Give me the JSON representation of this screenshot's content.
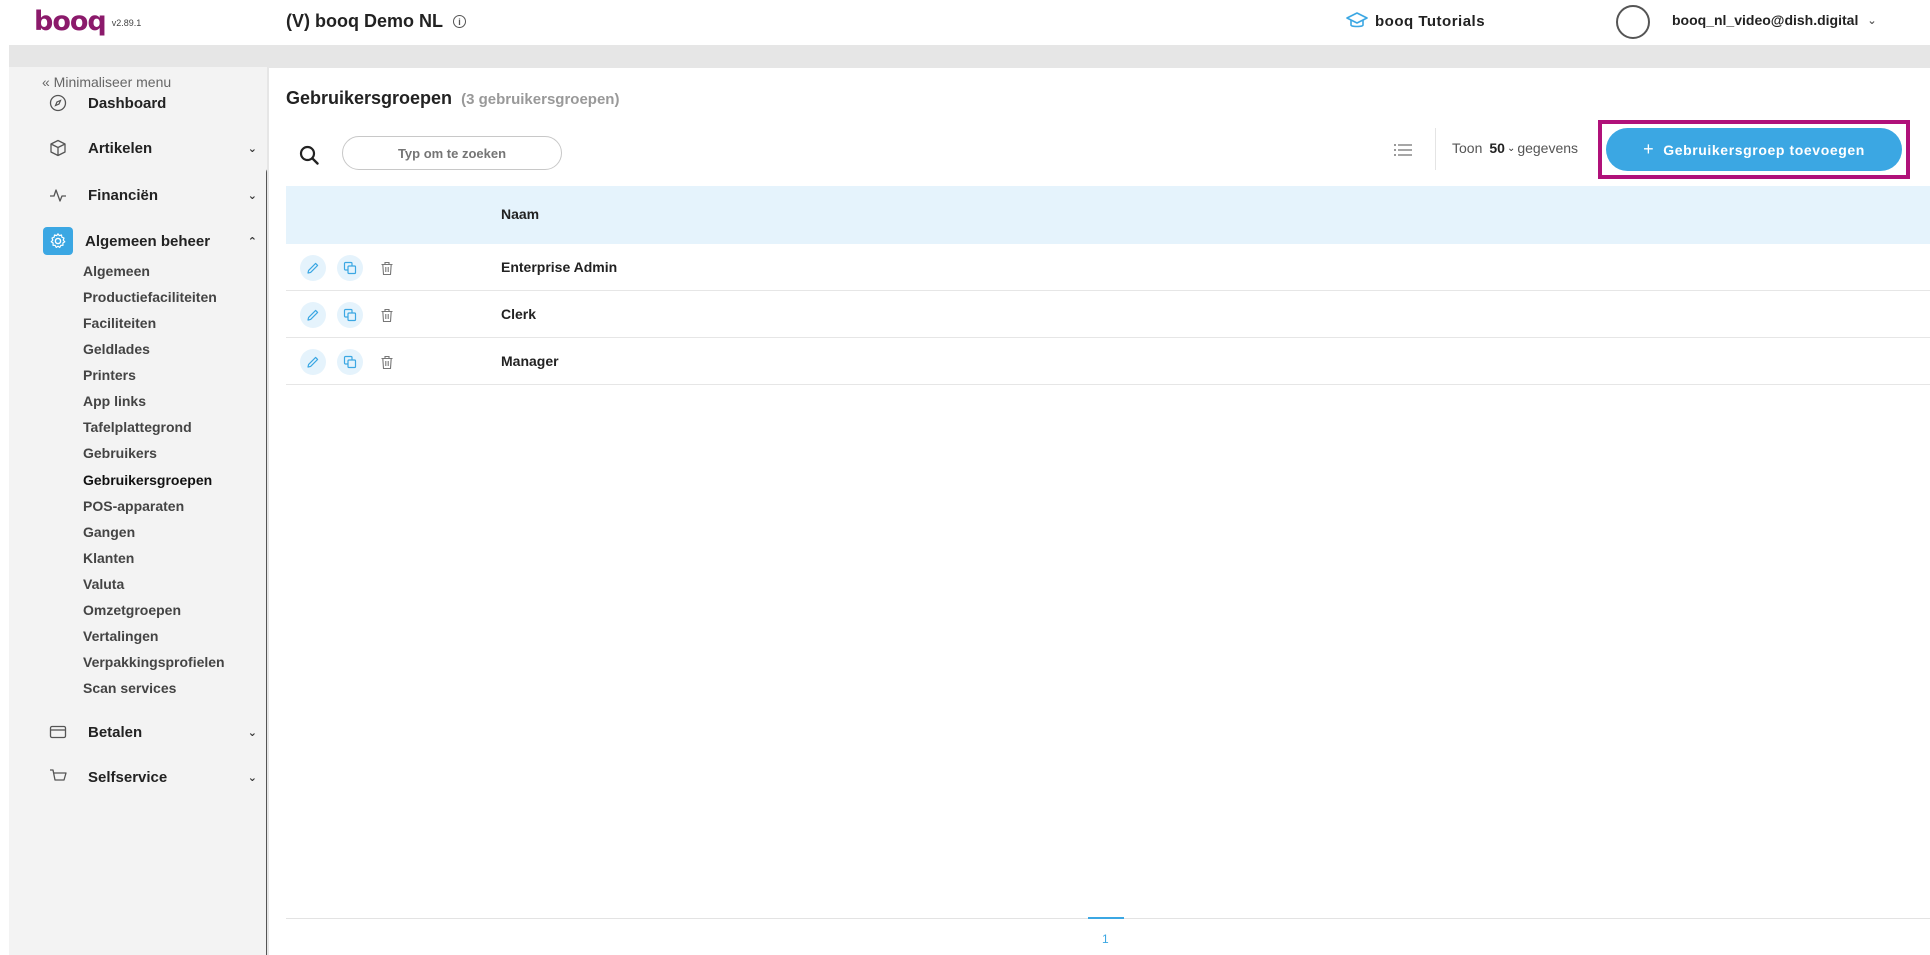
{
  "app": {
    "logo_text": "booq",
    "version": "v2.89.1",
    "venue": "(V) booq Demo NL",
    "info_icon": "info-icon",
    "tutorials_label": "booq Tutorials",
    "user_email": "booq_nl_video@dish.digital"
  },
  "sidebar": {
    "collapse_label": "« Minimaliseer menu",
    "items": [
      {
        "label": "Dashboard",
        "icon": "compass-icon"
      },
      {
        "label": "Artikelen",
        "icon": "box-icon"
      },
      {
        "label": "Financiën",
        "icon": "pulse-icon"
      },
      {
        "label": "Algemeen beheer",
        "icon": "gear-icon"
      },
      {
        "label": "Betalen",
        "icon": "card-icon"
      },
      {
        "label": "Selfservice",
        "icon": "cart-icon"
      }
    ],
    "sub_items": [
      "Algemeen",
      "Productiefaciliteiten",
      "Faciliteiten",
      "Geldlades",
      "Printers",
      "App links",
      "Tafelplattegrond",
      "Gebruikers",
      "Gebruikersgroepen",
      "POS-apparaten",
      "Gangen",
      "Klanten",
      "Valuta",
      "Omzetgroepen",
      "Vertalingen",
      "Verpakkingsprofielen",
      "Scan services"
    ]
  },
  "main": {
    "title": "Gebruikersgroepen",
    "count": "(3 gebruikersgroepen)",
    "search_placeholder": "Typ om te zoeken",
    "page_size_prefix": "Toon",
    "page_size_value": "50",
    "page_size_suffix": "gegevens",
    "add_button_label": "Gebruikersgroep toevoegen",
    "column_name": "Naam",
    "rows": [
      "Enterprise Admin",
      "Clerk",
      "Manager"
    ],
    "current_page": "1"
  },
  "colors": {
    "accent": "#3ba7e3",
    "highlight": "#b0117a",
    "brand": "#8b1a6b",
    "table_header": "#e5f3fc"
  }
}
